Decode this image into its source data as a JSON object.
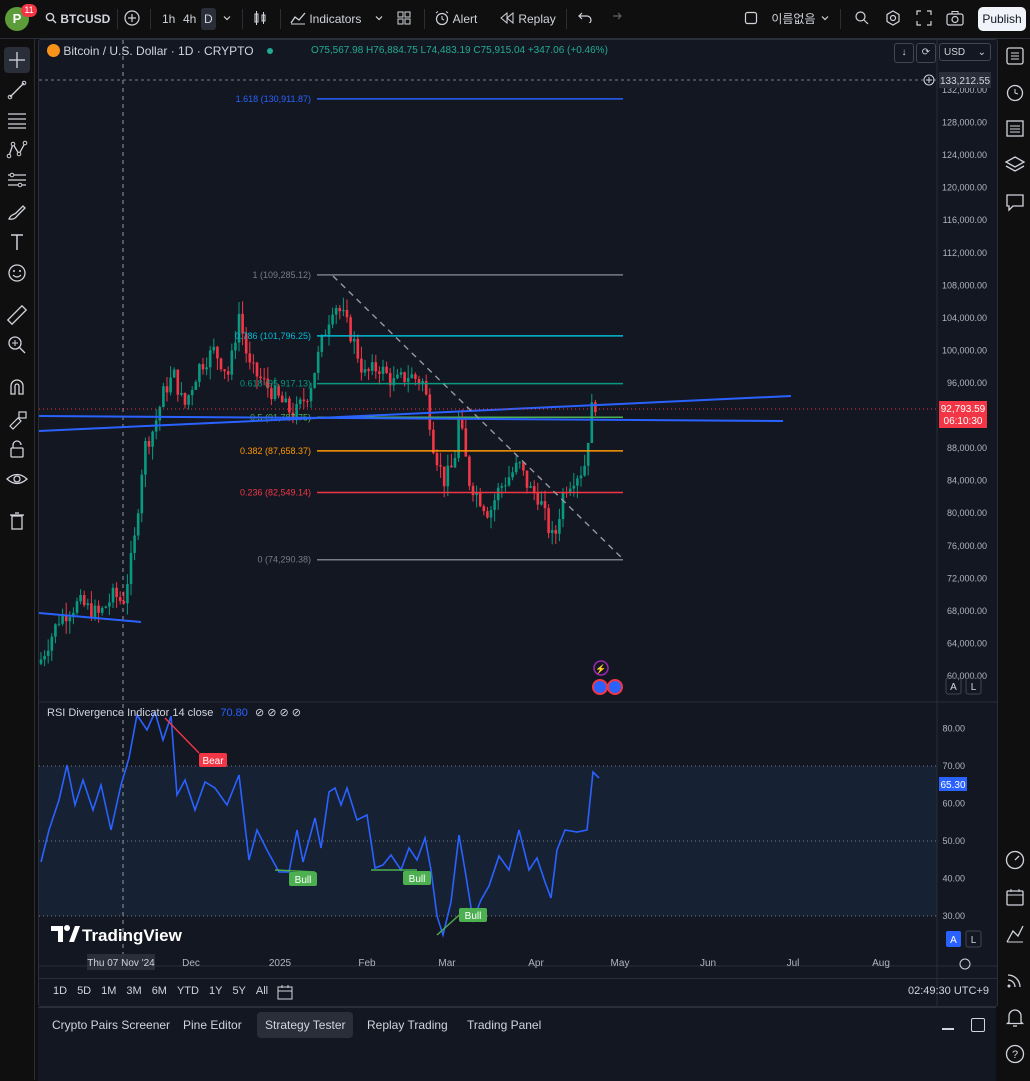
{
  "topbar": {
    "avatar_letter": "P",
    "notification_count": "11",
    "symbol": "BTCUSD",
    "timeframes": [
      "1h",
      "4h",
      "D"
    ],
    "active_timeframe": "D",
    "indicators_label": "Indicators",
    "alert_label": "Alert",
    "replay_label": "Replay",
    "layout_name": "이름없음",
    "publish_label": "Publish"
  },
  "chart": {
    "title": "Bitcoin / U.S. Dollar · 1D · CRYPTO",
    "ohlc": "O75,567.98 H76,884.75 L74,483.19 C75,915.04 +347.06 (+0.46%)",
    "currency": "USD",
    "top_price_label": "133,212.55",
    "current_price": "92,793.59",
    "countdown": "06:10:30",
    "price_ticks": [
      "132,000.00",
      "128,000.00",
      "124,000.00",
      "120,000.00",
      "116,000.00",
      "112,000.00",
      "108,000.00",
      "104,000.00",
      "100,000.00",
      "96,000.00",
      "88,000.00",
      "84,000.00",
      "80,000.00",
      "76,000.00",
      "72,000.00",
      "68,000.00",
      "64,000.00",
      "60,000.00"
    ],
    "fib_levels": [
      {
        "label": "1.618 (130,911.87)",
        "color": "#2962ff"
      },
      {
        "label": "1 (109,285.12)",
        "color": "#787b86"
      },
      {
        "label": "0.786 (101,796.25)",
        "color": "#00bcd4"
      },
      {
        "label": "0.618 (95,917.13)",
        "color": "#089981"
      },
      {
        "label": "0.5 (91,787.75)",
        "color": "#4caf50"
      },
      {
        "label": "0.382 (87,658.37)",
        "color": "#ff9800"
      },
      {
        "label": "0.236 (82,549.14)",
        "color": "#f23645"
      },
      {
        "label": "0 (74,290.38)",
        "color": "#787b86"
      }
    ],
    "scale_buttons": [
      "A",
      "L"
    ]
  },
  "rsi": {
    "title": "RSI Divergence Indicator 14 close",
    "value": "70.80",
    "current_value": "65.30",
    "ticks": [
      "80.00",
      "70.00",
      "60.00",
      "50.00",
      "40.00",
      "30.00"
    ],
    "signals": [
      {
        "label": "Bear",
        "color": "#f23645"
      },
      {
        "label": "Bull",
        "color": "#4caf50"
      },
      {
        "label": "Bull",
        "color": "#4caf50"
      },
      {
        "label": "Bull",
        "color": "#4caf50"
      }
    ],
    "watermark": "TradingView"
  },
  "time_axis": {
    "crosshair_label": "Thu 07 Nov '24",
    "labels": [
      "Dec",
      "2025",
      "Feb",
      "Mar",
      "Apr",
      "May",
      "Jun",
      "Jul",
      "Aug"
    ]
  },
  "range_bar": {
    "ranges": [
      "1D",
      "5D",
      "1M",
      "3M",
      "6M",
      "YTD",
      "1Y",
      "5Y",
      "All"
    ],
    "clock": "02:49:30 UTC+9"
  },
  "bottom_tabs": {
    "tabs": [
      "Crypto Pairs Screener",
      "Pine Editor",
      "Strategy Tester",
      "Replay Trading",
      "Trading Panel"
    ],
    "active": "Strategy Tester"
  },
  "colors": {
    "background": "#131722",
    "up_candle": "#089981",
    "down_candle": "#f23645",
    "trend_line": "#2962ff",
    "rsi_line": "#2962ff"
  }
}
